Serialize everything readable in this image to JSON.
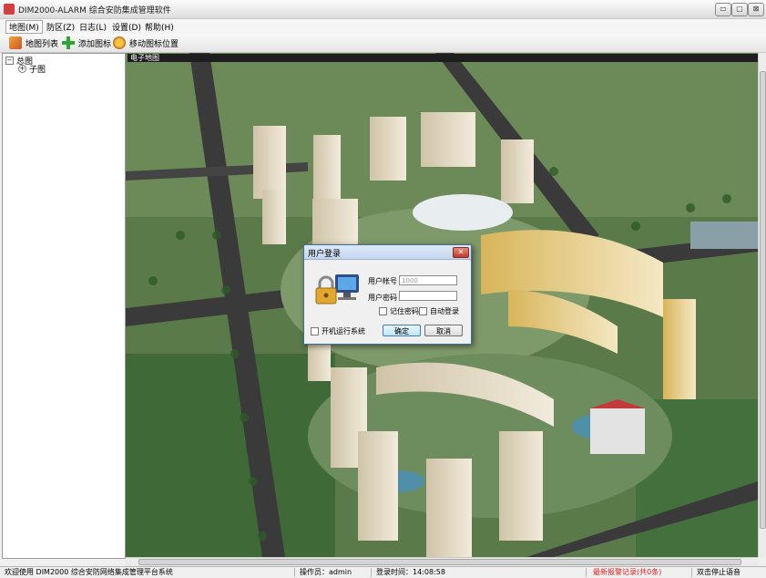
{
  "window": {
    "title": "DIM2000-ALARM 综合安防集成管理软件",
    "min_glyph": "▭",
    "max_glyph": "▢",
    "close_glyph": "⊠"
  },
  "menu": [
    {
      "label": "地图(M)"
    },
    {
      "label": "防区(Z)"
    },
    {
      "label": "日志(L)"
    },
    {
      "label": "设置(D)"
    },
    {
      "label": "帮助(H)"
    }
  ],
  "toolbar": {
    "map_list": "地图列表",
    "add_icon": "添加图标",
    "move_icon": "移动图标位置"
  },
  "tree": {
    "root": "总图",
    "child": "子图",
    "root_toggle": "−",
    "child_toggle": "+"
  },
  "map": {
    "label": "电子地图"
  },
  "dialog": {
    "title": "用户登录",
    "close": "✕",
    "user_label": "用户帐号",
    "user_value": "1000",
    "pwd_label": "用户密码",
    "remember": "记住密码",
    "auto_login": "自动登录",
    "startup": "开机运行系统",
    "ok": "确定",
    "cancel": "取消"
  },
  "status": {
    "welcome": "欢迎使用 DIM2000 综合安防网络集成管理平台系统",
    "operator": "操作员：admin",
    "login_time": "登录时间：14:08:58",
    "alarm": "最新报警记录(共0条)",
    "stop_sound": "双击停止语音"
  },
  "colors": {
    "alarm_text": "#e02020",
    "dialog_border": "#3c6ea8",
    "close_red": "#c0392b",
    "grass": "#5f7f4f",
    "road": "#3a3a3a"
  }
}
